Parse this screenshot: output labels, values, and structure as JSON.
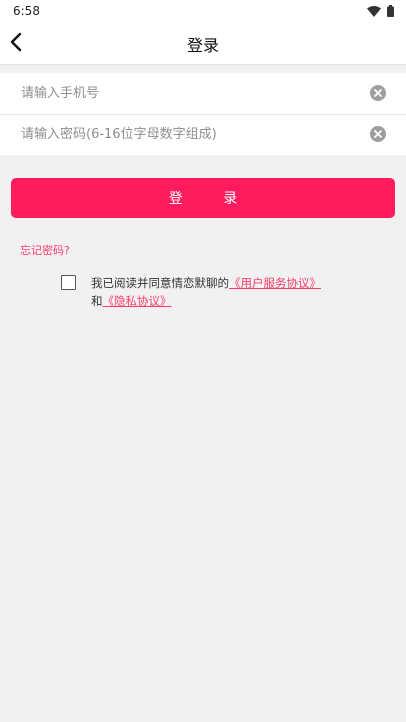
{
  "status": {
    "time": "6:58"
  },
  "appbar": {
    "title": "登录"
  },
  "form": {
    "phone_placeholder": "请输入手机号",
    "password_placeholder": "请输入密码(6-16位字母数字组成)"
  },
  "login_label": "登 录",
  "forgot_label": "忘记密码?",
  "agreement": {
    "prefix": "我已阅读并同意情恋默聊的",
    "user_link": "《用户服务协议》",
    "and": "和",
    "privacy_link": "《隐私协议》"
  },
  "colors": {
    "accent": "#ff1b5e",
    "link": "#ff3d6b"
  },
  "icons": {
    "back": "chevron-left-icon",
    "clear": "clear-circle-icon",
    "wifi": "wifi-icon",
    "battery": "battery-icon"
  }
}
